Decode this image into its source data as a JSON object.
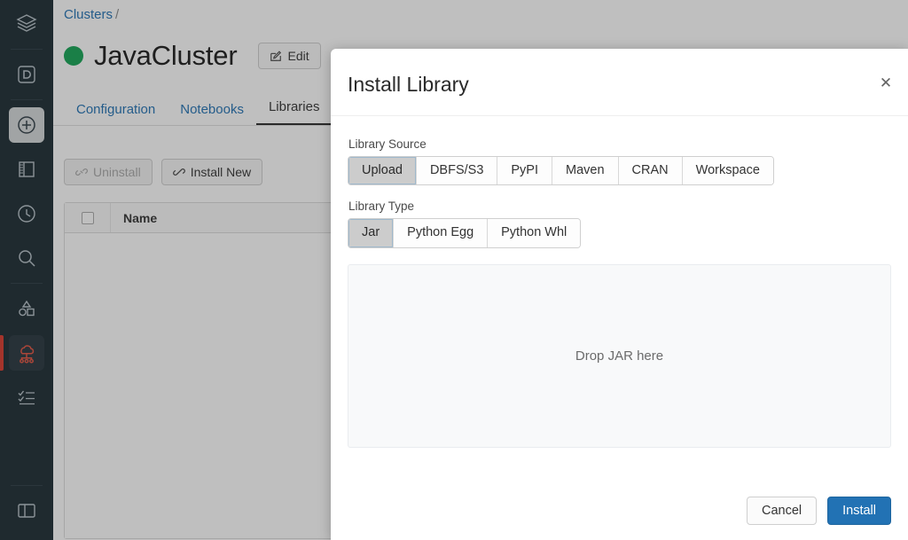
{
  "colors": {
    "rail_bg": "#1b2a32",
    "accent_blue": "#2272b4",
    "status_green": "#13a453",
    "selection_red": "#d9392b"
  },
  "rail": {
    "items": [
      {
        "name": "layers-icon",
        "label": "Workspace"
      },
      {
        "name": "databricks-d-icon",
        "label": "Databricks"
      },
      {
        "name": "plus-circle-icon",
        "label": "Create"
      },
      {
        "name": "notebook-icon",
        "label": "Notebooks"
      },
      {
        "name": "clock-icon",
        "label": "Recents"
      },
      {
        "name": "search-icon",
        "label": "Search"
      },
      {
        "name": "shapes-icon",
        "label": "Data"
      },
      {
        "name": "clusters-icon",
        "label": "Clusters"
      },
      {
        "name": "checklist-icon",
        "label": "Jobs"
      },
      {
        "name": "panel-toggle-icon",
        "label": "Toggle sidebar"
      }
    ]
  },
  "breadcrumb": {
    "root": "Clusters",
    "separator": "/"
  },
  "cluster": {
    "name": "JavaCluster",
    "status": "running",
    "edit_label": "Edit",
    "edit_icon": "pencil-square-icon"
  },
  "tabs": [
    {
      "label": "Configuration",
      "active": false
    },
    {
      "label": "Notebooks",
      "active": false
    },
    {
      "label": "Libraries",
      "active": true
    }
  ],
  "toolbar": {
    "uninstall_label": "Uninstall",
    "uninstall_icon": "unlink-icon",
    "uninstall_disabled": true,
    "install_new_label": "Install New",
    "install_new_icon": "link-icon"
  },
  "table": {
    "columns": [
      "Name"
    ],
    "rows": [],
    "select_all_checked": false
  },
  "modal": {
    "title": "Install Library",
    "close_icon": "close-icon",
    "library_source": {
      "label": "Library Source",
      "options": [
        "Upload",
        "DBFS/S3",
        "PyPI",
        "Maven",
        "CRAN",
        "Workspace"
      ],
      "selected": "Upload"
    },
    "library_type": {
      "label": "Library Type",
      "options": [
        "Jar",
        "Python Egg",
        "Python Whl"
      ],
      "selected": "Jar"
    },
    "dropzone": {
      "text": "Drop JAR here"
    },
    "footer": {
      "cancel_label": "Cancel",
      "install_label": "Install"
    }
  }
}
